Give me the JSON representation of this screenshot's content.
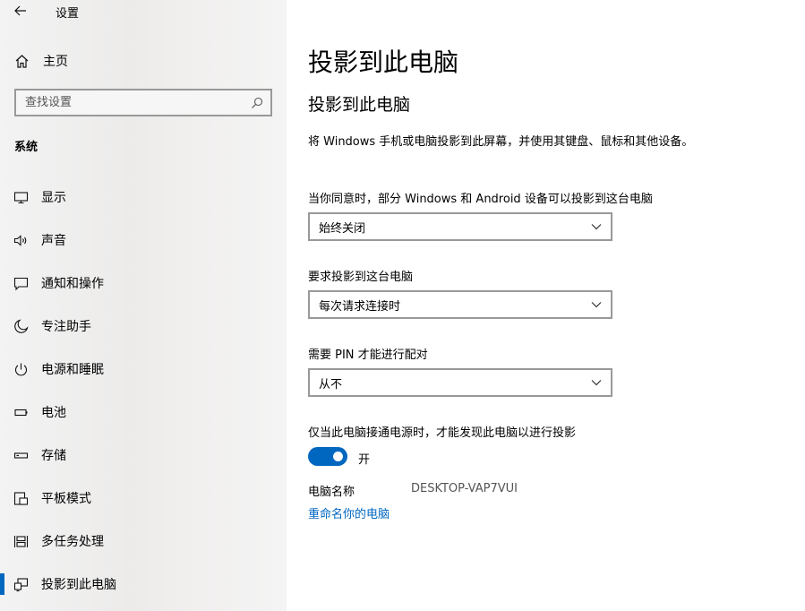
{
  "window": {
    "title": "设置"
  },
  "sidebar": {
    "home_label": "主页",
    "search": {
      "placeholder": "查找设置"
    },
    "section_title": "系统",
    "items": [
      {
        "label": "显示",
        "icon": "display-icon",
        "active": false
      },
      {
        "label": "声音",
        "icon": "speaker-icon",
        "active": false
      },
      {
        "label": "通知和操作",
        "icon": "notification-icon",
        "active": false
      },
      {
        "label": "专注助手",
        "icon": "moon-icon",
        "active": false
      },
      {
        "label": "电源和睡眠",
        "icon": "power-icon",
        "active": false
      },
      {
        "label": "电池",
        "icon": "battery-icon",
        "active": false
      },
      {
        "label": "存储",
        "icon": "storage-icon",
        "active": false
      },
      {
        "label": "平板模式",
        "icon": "tablet-icon",
        "active": false
      },
      {
        "label": "多任务处理",
        "icon": "multitask-icon",
        "active": false
      },
      {
        "label": "投影到此电脑",
        "icon": "project-icon",
        "active": true
      }
    ]
  },
  "main": {
    "page_title": "投影到此电脑",
    "sub_title": "投影到此电脑",
    "description": "将 Windows 手机或电脑投影到此屏幕，并使用其键盘、鼠标和其他设备。",
    "setting1": {
      "label": "当你同意时，部分 Windows 和 Android 设备可以投影到这台电脑",
      "value": "始终关闭"
    },
    "setting2": {
      "label": "要求投影到这台电脑",
      "value": "每次请求连接时"
    },
    "setting3": {
      "label": "需要 PIN 才能进行配对",
      "value": "从不"
    },
    "setting4": {
      "label": "仅当此电脑接通电源时，才能发现此电脑以进行投影",
      "toggle_state": "开",
      "toggle_on": true
    },
    "pc_name_label": "电脑名称",
    "pc_name_value": "DESKTOP-VAP7VUI",
    "rename_link": "重命名你的电脑"
  },
  "colors": {
    "accent": "#0067c0",
    "sidebar_bg": "#f0efee"
  }
}
